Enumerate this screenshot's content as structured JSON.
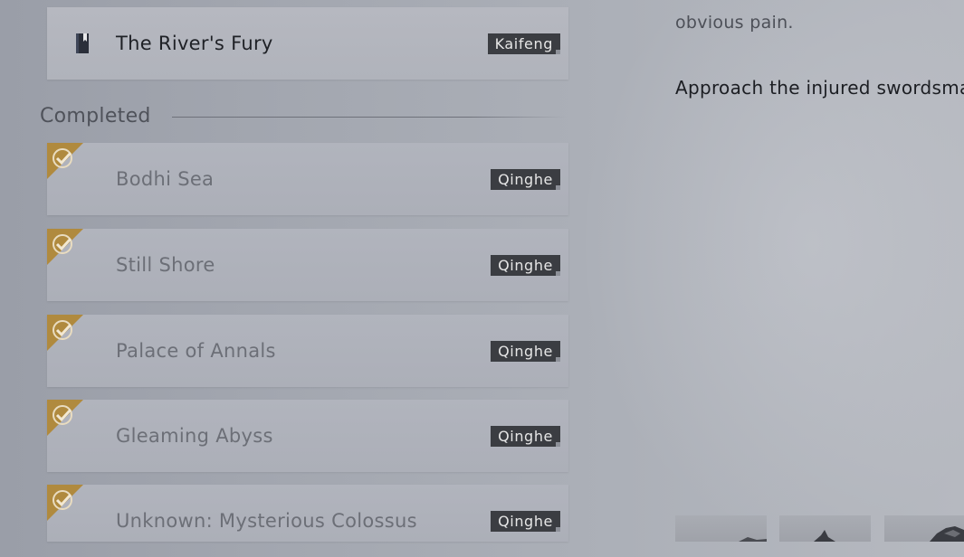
{
  "active_quest": {
    "name": "The River's Fury",
    "region": "Kaifeng",
    "icon": "book-icon"
  },
  "completed_section": {
    "title": "Completed"
  },
  "completed_quests": [
    {
      "name": "Bodhi Sea",
      "region": "Qinghe",
      "icon": "checkmark-icon"
    },
    {
      "name": "Still Shore",
      "region": "Qinghe",
      "icon": "checkmark-icon"
    },
    {
      "name": "Palace of Annals",
      "region": "Qinghe",
      "icon": "checkmark-icon"
    },
    {
      "name": "Gleaming Abyss",
      "region": "Qinghe",
      "icon": "checkmark-icon"
    },
    {
      "name": "Unknown: Mysterious Colossus",
      "region": "Qinghe",
      "icon": "checkmark-icon"
    }
  ],
  "description": {
    "line_muted": "obvious pain.",
    "line_main": "Approach the injured swordsma"
  },
  "colors": {
    "check_gold": "#b08a3e",
    "tag_bg": "#3b3d42",
    "active_text": "#1f2126",
    "muted_text": "#6c6f77"
  }
}
